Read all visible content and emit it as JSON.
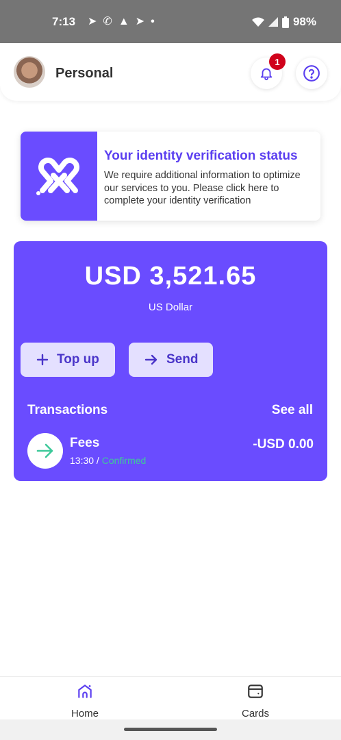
{
  "status_bar": {
    "time": "7:13",
    "battery": "98%",
    "notification_icons": [
      "telegram-icon",
      "whatsapp-icon",
      "warning-icon",
      "telegram-icon",
      "dot-icon"
    ]
  },
  "header": {
    "title": "Personal",
    "notification_count": "1"
  },
  "verification": {
    "title": "Your identity verification status",
    "text": "We require additional information to optimize our services to you. Please click here to complete your identity verification"
  },
  "balance": {
    "amount": "USD 3,521.65",
    "currency_name": "US Dollar",
    "topup_label": "Top up",
    "send_label": "Send"
  },
  "transactions": {
    "title": "Transactions",
    "see_all_label": "See all",
    "items": [
      {
        "name": "Fees",
        "time": "13:30",
        "separator": " / ",
        "status": "Confirmed",
        "amount": "-USD 0.00"
      }
    ]
  },
  "bottom_nav": {
    "items": [
      {
        "label": "Home"
      },
      {
        "label": "Cards"
      }
    ]
  },
  "colors": {
    "accent": "#6a4cff",
    "button_bg": "#e4e0ff",
    "confirmed": "#3ec99a",
    "badge": "#d0021b"
  }
}
